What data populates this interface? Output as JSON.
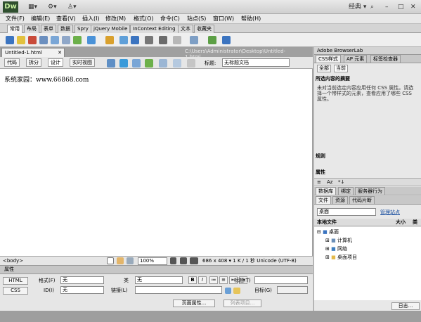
{
  "app": {
    "logo": "Dw",
    "workspace": "经典 ▾"
  },
  "menubar": [
    "文件(F)",
    "编辑(E)",
    "查看(V)",
    "插入(I)",
    "修改(M)",
    "格式(O)",
    "命令(C)",
    "站点(S)",
    "窗口(W)",
    "帮助(H)"
  ],
  "insert_tabs": [
    "常用",
    "布局",
    "表单",
    "数据",
    "Spry",
    "jQuery Mobile",
    "InContext Editing",
    "文本",
    "收藏夹"
  ],
  "document": {
    "tab": "Untitled-1.html",
    "path": "C:\\Users\\Administrator\\Desktop\\Untitled-1.html",
    "view_buttons": [
      "代码",
      "拆分",
      "设计",
      "实时视图"
    ],
    "title_label": "标题:",
    "title_value": "无标题文档",
    "content": "系统家园：www.66868.com"
  },
  "statusbar": {
    "tag": "<body>",
    "zoom": "100%",
    "info": "686 x 408 ▾ 1 K / 1 秒 Unicode (UTF-8)"
  },
  "properties": {
    "header": "属性",
    "html_label": "HTML",
    "css_label": "CSS",
    "format_label": "格式(F)",
    "format_value": "无",
    "id_label": "ID(I)",
    "id_value": "无",
    "class_label": "类",
    "class_value": "无",
    "link_label": "链接(L)",
    "title_label": "标题(T)",
    "target_label": "目标(G)",
    "page_props_button": "页面属性...",
    "list_item_button": "列表项目..."
  },
  "right_panel": {
    "browserlab": "Adobe BrowserLab",
    "tabs": [
      "CSS样式",
      "AP 元素",
      "标签检查器"
    ],
    "subtabs": [
      "全部",
      "当前"
    ],
    "summary_title": "所选内容的摘要",
    "summary_text": "未对当前选定内容应用任何 CSS 属性。请选择一个带样式的元素，查看应用了哪些 CSS 属性。",
    "rules_label": "规则",
    "props_label": "属性",
    "db_tabs": [
      "数据库",
      "绑定",
      "服务器行为"
    ],
    "file_tabs": [
      "文件",
      "资源",
      "代码片断"
    ],
    "location": "桌面",
    "manage_sites": "管理站点",
    "col_local": "本地文件",
    "col_size": "大小",
    "col_type": "类",
    "tree": [
      "桌面",
      "计算机",
      "网络",
      "桌面项目"
    ],
    "log_button": "日志..."
  }
}
